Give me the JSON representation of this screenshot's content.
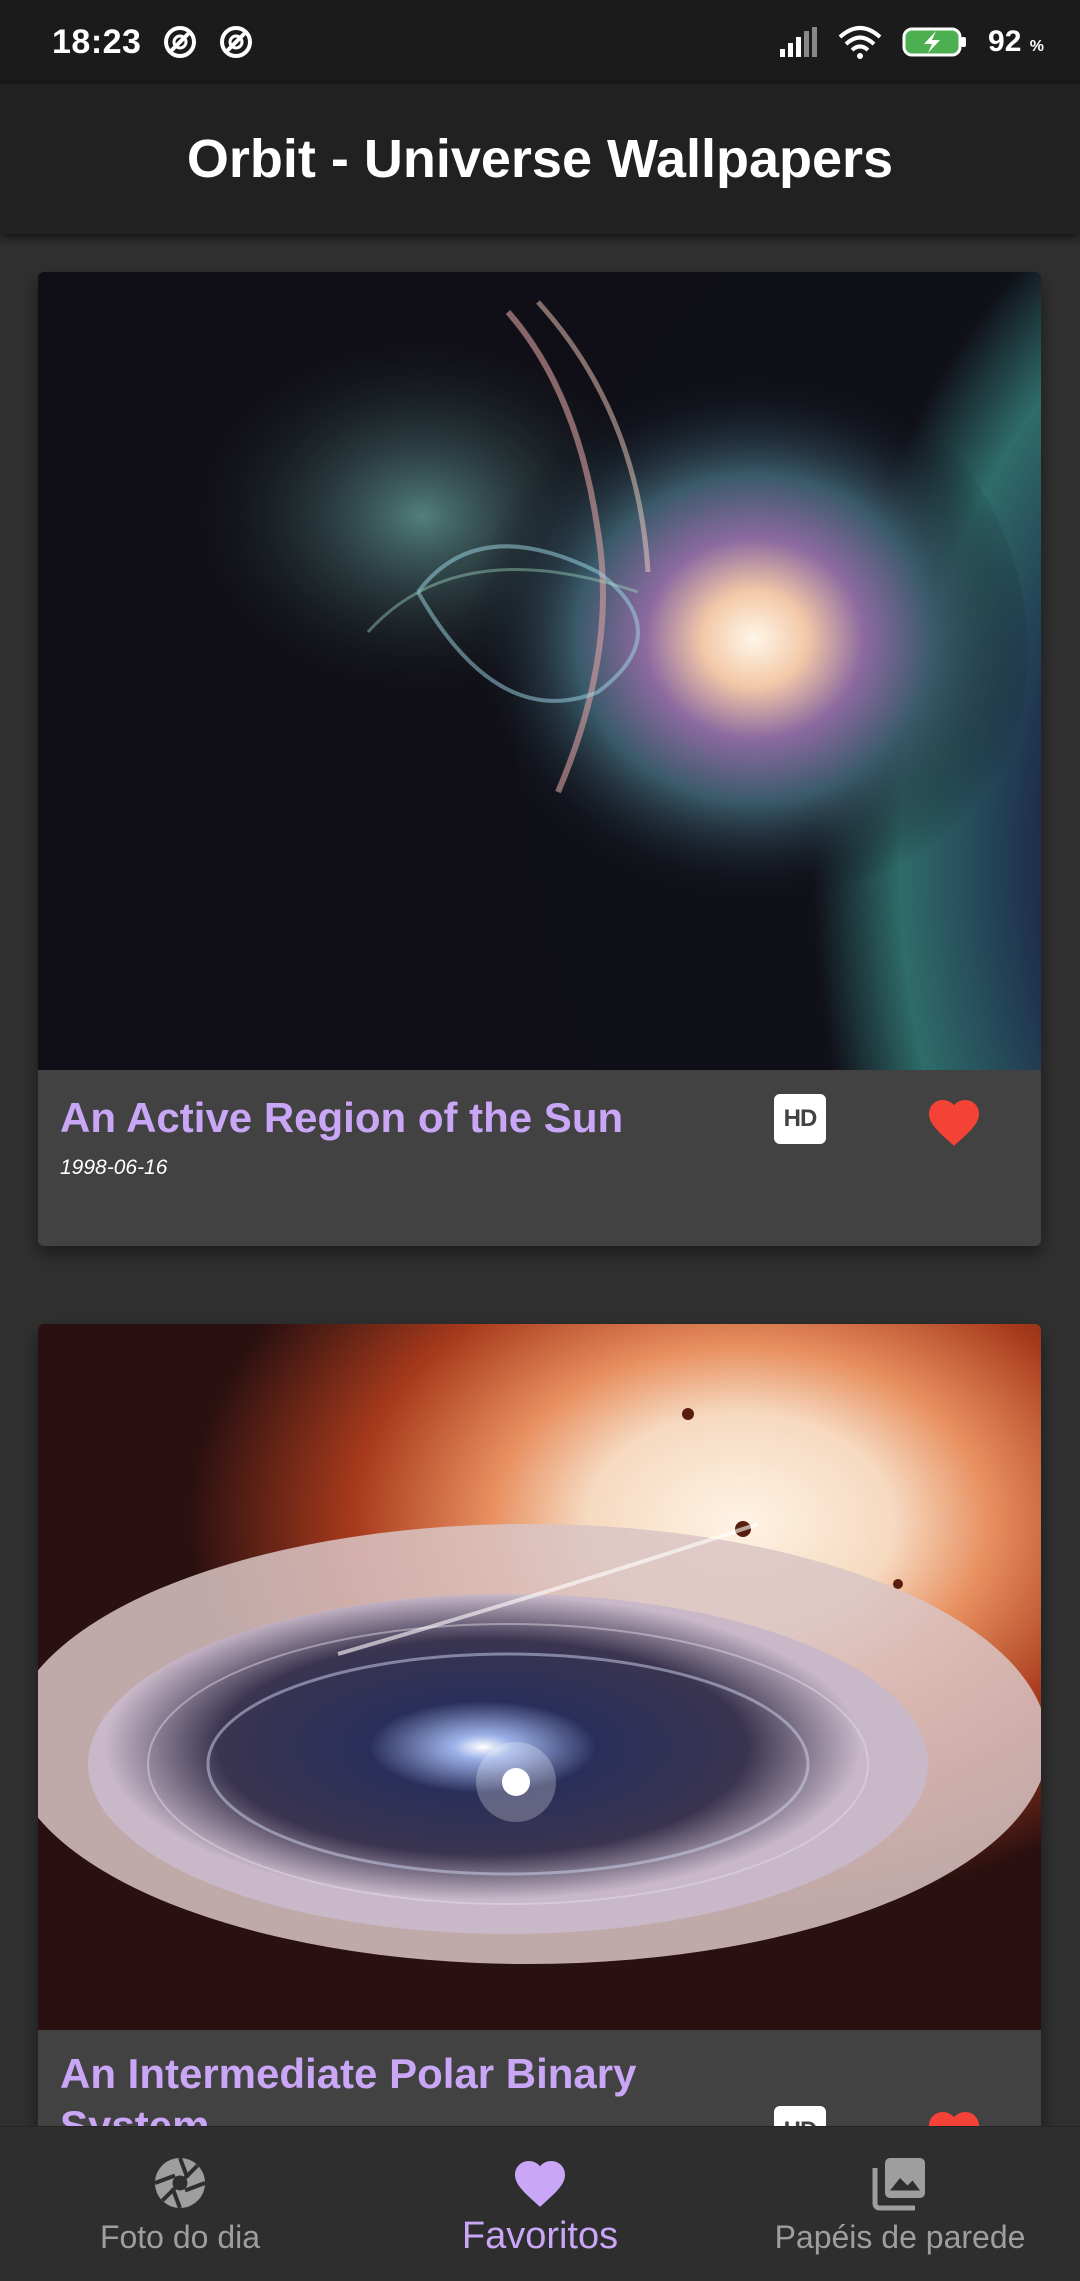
{
  "status_bar": {
    "time": "18:23",
    "battery_percent": "92",
    "battery_unit": "%",
    "icons": [
      "notification-icon",
      "notification-icon",
      "signal-icon",
      "wifi-icon",
      "battery-charging-icon"
    ]
  },
  "app_bar": {
    "title": "Orbit - Universe Wallpapers"
  },
  "cards": [
    {
      "title": "An Active Region of the Sun",
      "date": "1998-06-16",
      "hd_label": "HD",
      "favorited": true
    },
    {
      "title": "An Intermediate Polar Binary System",
      "date": "",
      "hd_label": "HD",
      "favorited": true
    }
  ],
  "bottom_nav": {
    "items": [
      {
        "label": "Foto do dia",
        "icon": "camera-aperture-icon",
        "active": false
      },
      {
        "label": "Favoritos",
        "icon": "heart-icon",
        "active": true
      },
      {
        "label": "Papéis de parede",
        "icon": "photo-library-icon",
        "active": false
      }
    ]
  },
  "colors": {
    "accent": "#caa6f7",
    "favorite": "#f44336",
    "background": "#303030",
    "card": "#424242",
    "app_bar": "#212121"
  }
}
